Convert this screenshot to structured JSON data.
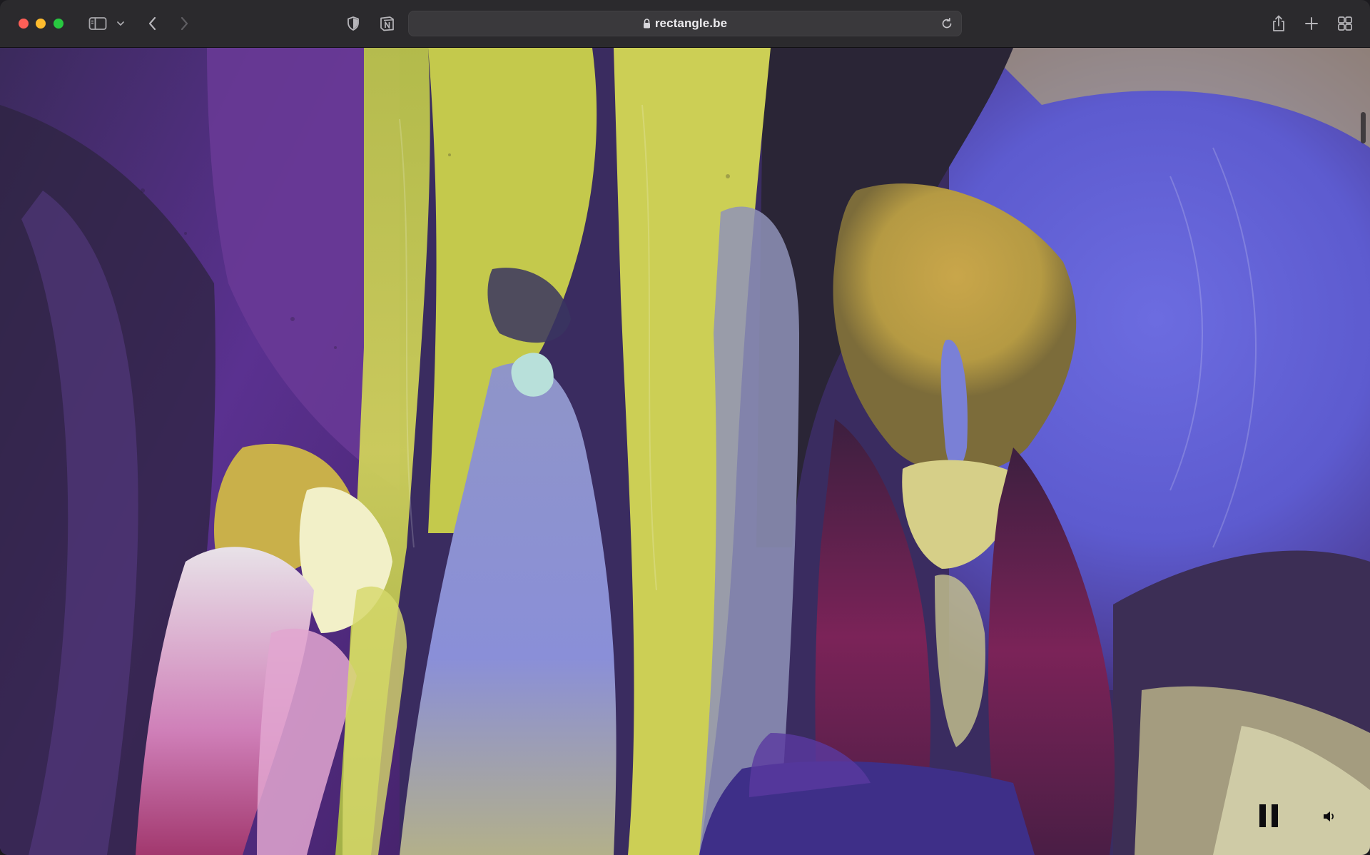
{
  "browser": {
    "url": "rectangle.be",
    "traffic_lights": {
      "close": "#fe5f57",
      "minimize": "#febc2e",
      "maximize": "#28c840"
    },
    "toolbar_icons": [
      "sidebar-toggle-icon",
      "chevron-down-icon",
      "back-icon",
      "forward-icon",
      "privacy-shield-icon",
      "notion-extension-icon",
      "lock-icon",
      "reload-icon",
      "share-icon",
      "new-tab-icon",
      "tab-overview-icon"
    ]
  },
  "media": {
    "controls": [
      "pause-icon",
      "speaker-icon"
    ]
  },
  "colors": {
    "toolbar_bg": "#2b2a2d",
    "address_bg": "#3a393c",
    "art_purple": "#4a2f7f",
    "art_violet": "#6f6bd6",
    "art_yellow": "#c9c548",
    "art_magenta": "#8a2b63"
  }
}
